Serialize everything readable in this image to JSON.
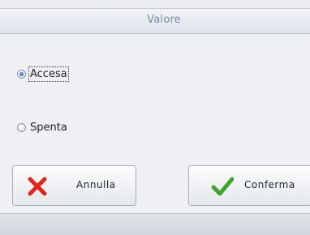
{
  "dialog": {
    "title": "Valore"
  },
  "options": [
    {
      "label": "Accesa",
      "checked": true
    },
    {
      "label": "Spenta",
      "checked": false
    }
  ],
  "buttons": {
    "cancel_label": "Annulla",
    "confirm_label": "Conferma",
    "cancel_icon": "x-icon",
    "confirm_icon": "checkmark-icon"
  },
  "colors": {
    "title_text": "#7a8aa2",
    "cancel_icon": "#e2231a",
    "confirm_icon": "#3aa52a"
  }
}
